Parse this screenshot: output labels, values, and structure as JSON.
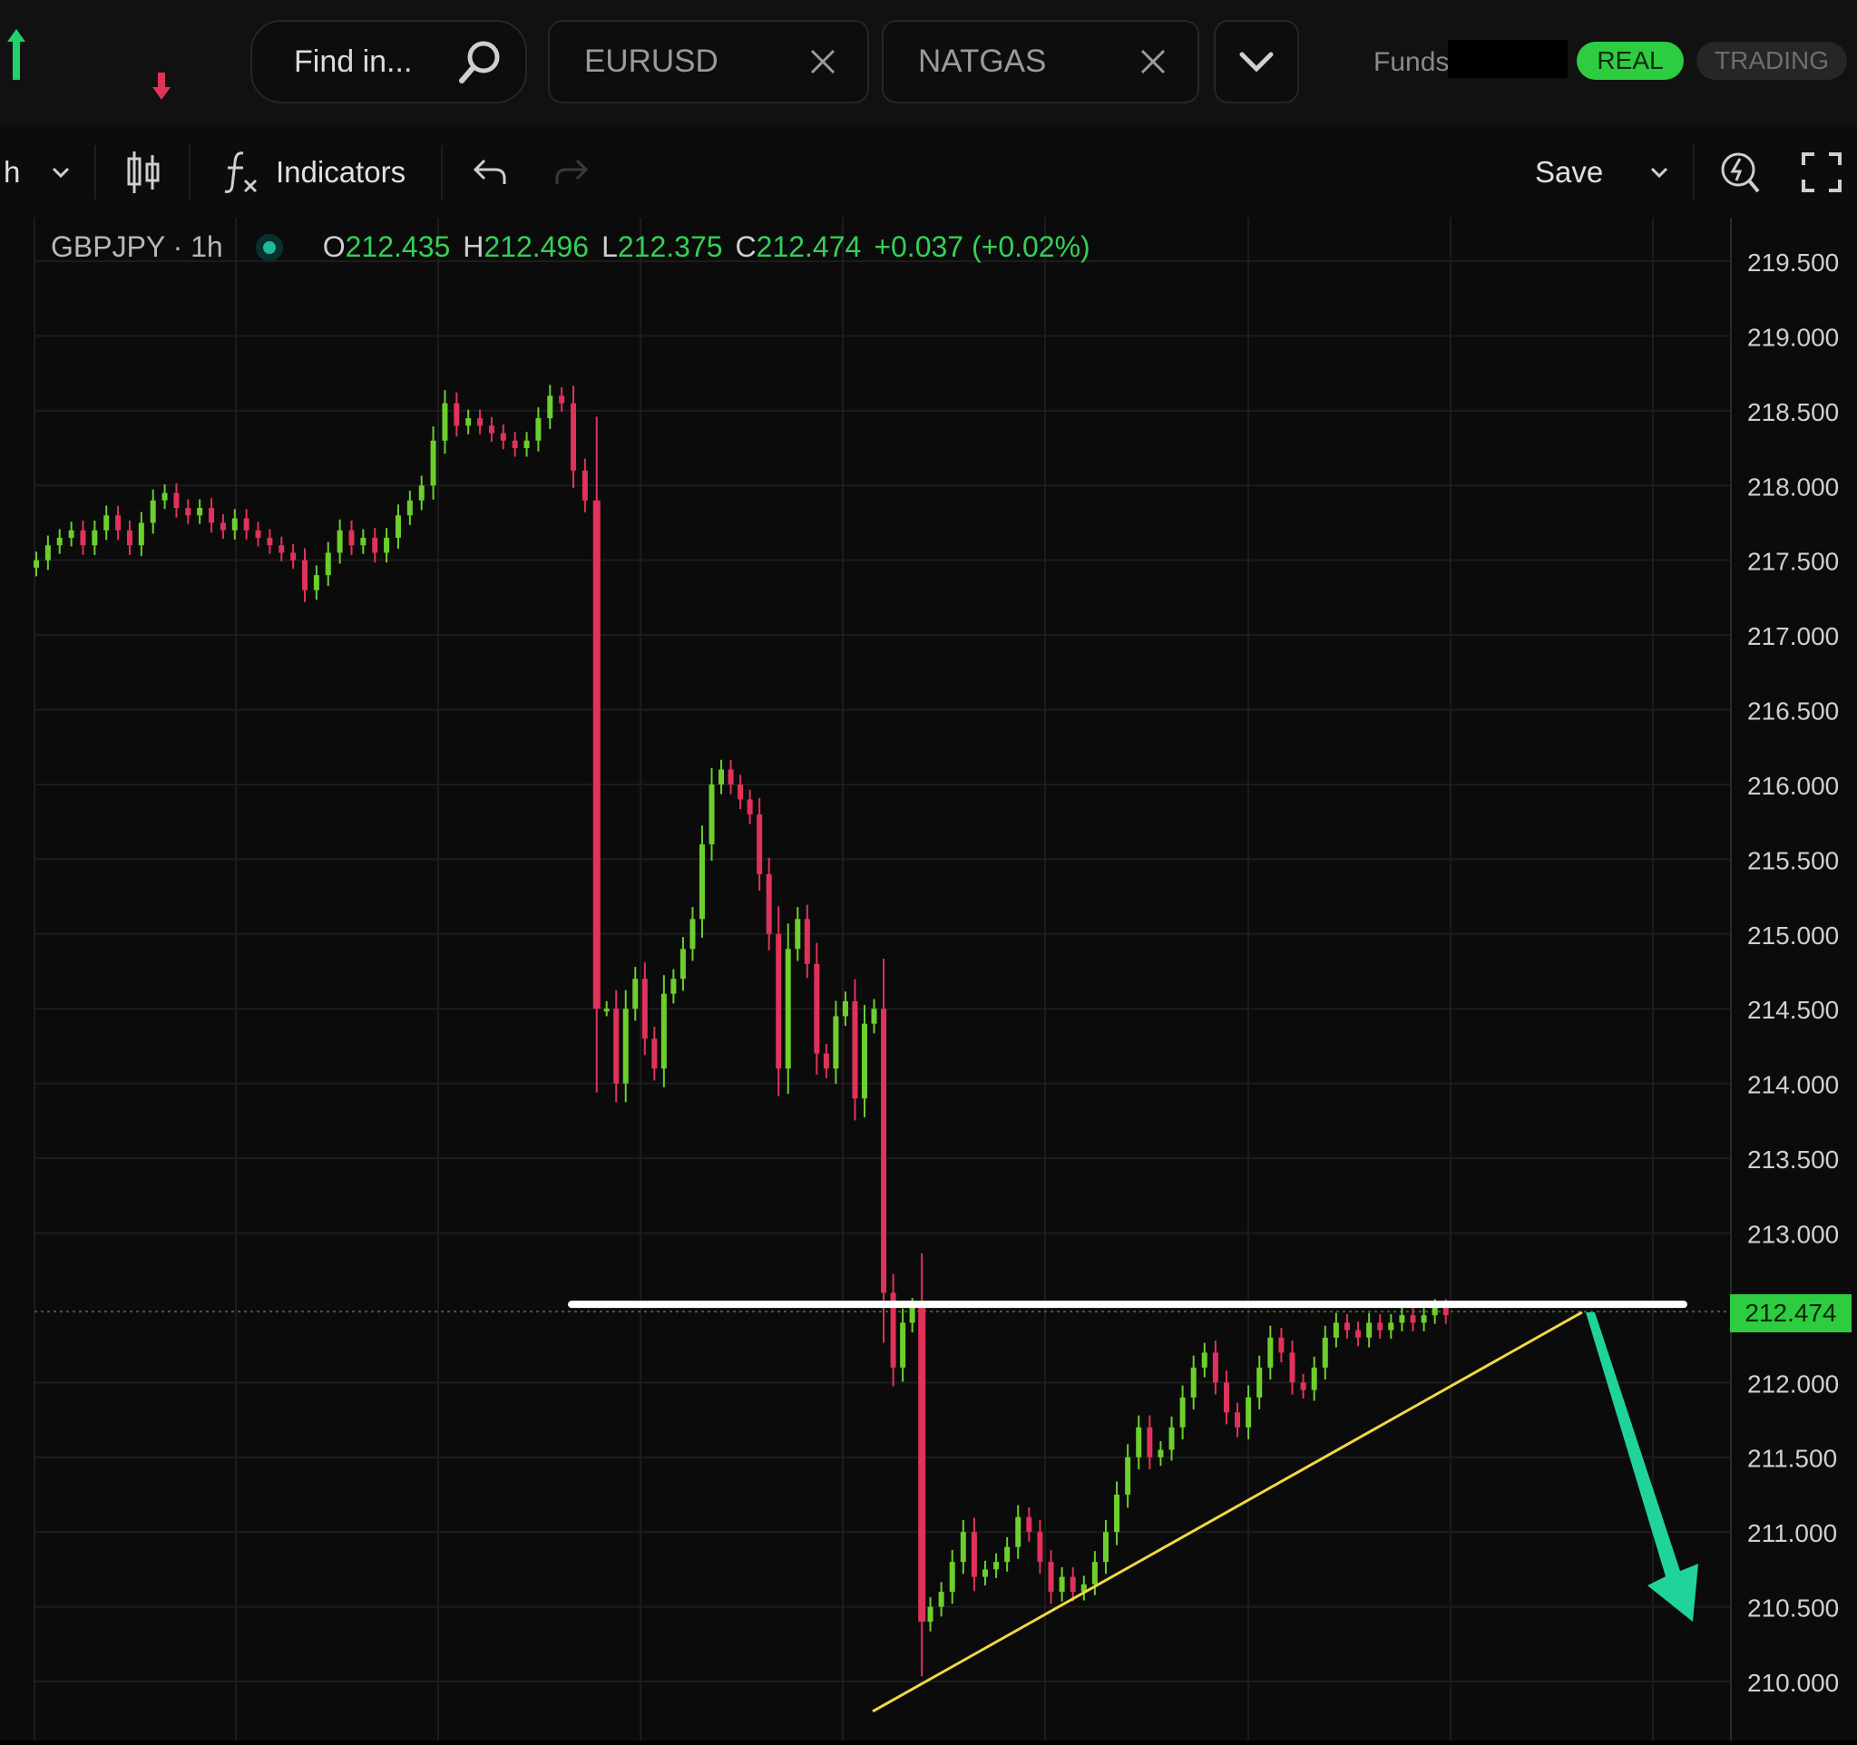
{
  "header": {
    "search_placeholder": "Find in...",
    "tabs": [
      {
        "label": "EURUSD"
      },
      {
        "label": "NATGAS"
      }
    ],
    "funds_label": "Funds:",
    "account_real": "REAL",
    "account_trading": "TRADING"
  },
  "toolbar": {
    "interval_label": "h",
    "indicators_label": "Indicators",
    "save_label": "Save"
  },
  "chart_data": {
    "type": "candlestick",
    "legend": {
      "symbol": "GBPJPY · 1h",
      "open_label": "O",
      "open": "212.435",
      "high_label": "H",
      "high": "212.496",
      "low_label": "L",
      "low": "212.375",
      "close_label": "C",
      "close": "212.474",
      "change": "+0.037 (+0.02%)"
    },
    "y_ticks": [
      "219.500",
      "219.000",
      "218.500",
      "218.000",
      "217.500",
      "217.000",
      "216.500",
      "216.000",
      "215.500",
      "215.000",
      "214.500",
      "214.000",
      "213.500",
      "213.000",
      "212.000",
      "211.500",
      "211.000",
      "210.500",
      "210.000"
    ],
    "ylim": [
      209.6,
      219.9
    ],
    "last_price": "212.474",
    "colors": {
      "up": "#6ccf2e",
      "down": "#e0325a",
      "horizontal_line": "#ffffff",
      "trendline": "#f2d743",
      "arrow": "#1fd39a",
      "grid": "#1c1c1c"
    },
    "series": [
      {
        "segment": "pre-drop",
        "close": [
          217.5,
          217.6,
          217.65,
          217.7,
          217.6,
          217.7,
          217.8,
          217.7,
          217.6,
          217.75,
          217.9,
          217.95,
          217.85,
          217.8,
          217.85,
          217.75,
          217.7,
          217.78,
          217.7,
          217.65,
          217.6,
          217.55,
          217.5,
          217.3,
          217.4,
          217.55,
          217.7,
          217.6,
          217.65,
          217.55,
          217.65,
          217.8,
          217.9,
          218.0,
          218.3,
          218.55,
          218.4,
          218.45,
          218.4,
          218.35,
          218.3,
          218.25,
          218.3,
          218.45,
          218.6,
          218.55,
          218.1,
          217.9
        ]
      },
      {
        "segment": "post-drop",
        "close": [
          214.5,
          214.0,
          214.5,
          214.7,
          214.3,
          214.1,
          214.6,
          214.7,
          214.9,
          215.1,
          215.6,
          216.0,
          216.1,
          216.0,
          215.9,
          215.8,
          215.4,
          215.0,
          214.1,
          214.9,
          215.1,
          214.8,
          214.2,
          214.1,
          214.45,
          214.55,
          213.9,
          214.4,
          214.5,
          212.6,
          212.1,
          212.4,
          212.5
        ]
      },
      {
        "segment": "recovery",
        "close": [
          210.5,
          210.6,
          210.8,
          211.0,
          210.7,
          210.75,
          210.8,
          210.9,
          211.1,
          211.0,
          210.8,
          210.6,
          210.7,
          210.6,
          210.65,
          210.8,
          211.0,
          211.25,
          211.5,
          211.7,
          211.5,
          211.55,
          211.7,
          211.9,
          212.1,
          212.2,
          212.0,
          211.8,
          211.7,
          211.9,
          212.1,
          212.3,
          212.2,
          212.0,
          211.95,
          212.1,
          212.3,
          212.4,
          212.35,
          212.3,
          212.4,
          212.35,
          212.4,
          212.45,
          212.4,
          212.45,
          212.5,
          212.45
        ]
      }
    ],
    "horizontal_line_price": 212.474,
    "trendline": {
      "from": [
        1,
        209.8
      ],
      "to": [
        127,
        212.47
      ]
    },
    "arrow": {
      "from_price": 212.47,
      "to_price": 210.4
    }
  }
}
